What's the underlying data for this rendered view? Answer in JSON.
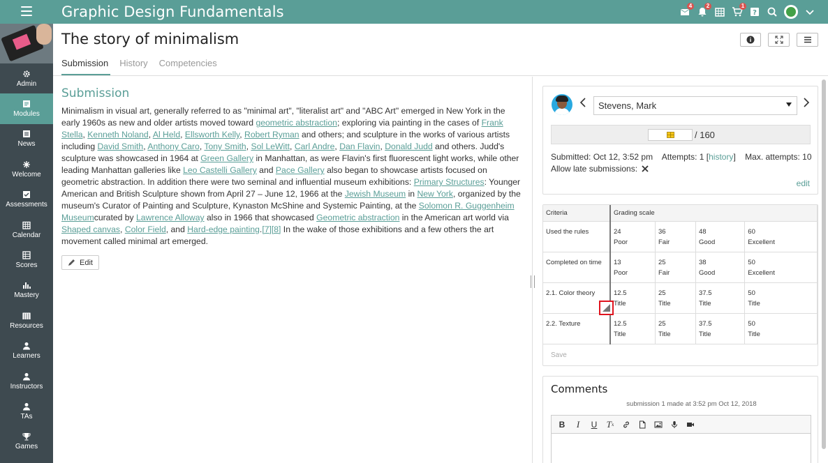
{
  "app": {
    "title": "Graphic Design Fundamentals",
    "badges": {
      "inbox": "4",
      "alerts": "2",
      "cart": "1"
    }
  },
  "sidebar": {
    "items": [
      {
        "label": "Admin",
        "icon": "gear-icon"
      },
      {
        "label": "Modules",
        "icon": "modules-icon",
        "active": true
      },
      {
        "label": "News",
        "icon": "news-icon"
      },
      {
        "label": "Welcome",
        "icon": "welcome-icon"
      },
      {
        "label": "Assessments",
        "icon": "assessments-icon"
      },
      {
        "label": "Calendar",
        "icon": "calendar-icon"
      },
      {
        "label": "Scores",
        "icon": "scores-icon"
      },
      {
        "label": "Mastery",
        "icon": "mastery-icon"
      },
      {
        "label": "Resources",
        "icon": "resources-icon"
      },
      {
        "label": "Learners",
        "icon": "person-icon"
      },
      {
        "label": "Instructors",
        "icon": "person-icon"
      },
      {
        "label": "TAs",
        "icon": "person-icon"
      },
      {
        "label": "Games",
        "icon": "trophy-icon"
      }
    ]
  },
  "page": {
    "title": "The story of minimalism",
    "tabs": [
      "Submission",
      "History",
      "Competencies"
    ]
  },
  "submission": {
    "heading": "Submission",
    "edit_label": "Edit"
  },
  "student": {
    "name": "Stevens, Mark",
    "score_max": "/ 160",
    "submitted": "Submitted: Oct 12, 3:52 pm",
    "attempts_prefix": "Attempts: 1 [",
    "attempts_link": "history",
    "attempts_suffix": "]",
    "max_attempts": "Max. attempts: 10",
    "late_label": "Allow late submissions:",
    "edit_label": "edit"
  },
  "rubric": {
    "col_criteria": "Criteria",
    "col_scale": "Grading scale",
    "rows": [
      {
        "criterion": "Used the rules",
        "levels": [
          {
            "pts": "24",
            "lbl": "Poor"
          },
          {
            "pts": "36",
            "lbl": "Fair"
          },
          {
            "pts": "48",
            "lbl": "Good"
          },
          {
            "pts": "60",
            "lbl": "Excellent"
          }
        ]
      },
      {
        "criterion": "Completed on time",
        "levels": [
          {
            "pts": "13",
            "lbl": "Poor"
          },
          {
            "pts": "25",
            "lbl": "Fair"
          },
          {
            "pts": "38",
            "lbl": "Good"
          },
          {
            "pts": "50",
            "lbl": "Excellent"
          }
        ]
      },
      {
        "criterion": "2.1. Color theory",
        "levels": [
          {
            "pts": "12.5",
            "lbl": "Title"
          },
          {
            "pts": "25",
            "lbl": "Title"
          },
          {
            "pts": "37.5",
            "lbl": "Title"
          },
          {
            "pts": "50",
            "lbl": "Title"
          }
        ]
      },
      {
        "criterion": "2.2. Texture",
        "levels": [
          {
            "pts": "12.5",
            "lbl": "Title"
          },
          {
            "pts": "25",
            "lbl": "Title"
          },
          {
            "pts": "37.5",
            "lbl": "Title"
          },
          {
            "pts": "50",
            "lbl": "Title"
          }
        ]
      }
    ],
    "save_label": "Save"
  },
  "comments": {
    "title": "Comments",
    "sub": "submission 1 made at 3:52 pm Oct 12, 2018"
  },
  "colors": {
    "brand": "#5a9e97",
    "sidebar": "#3e4a50",
    "badge": "#d9534f",
    "highlight": "#e0141e"
  }
}
